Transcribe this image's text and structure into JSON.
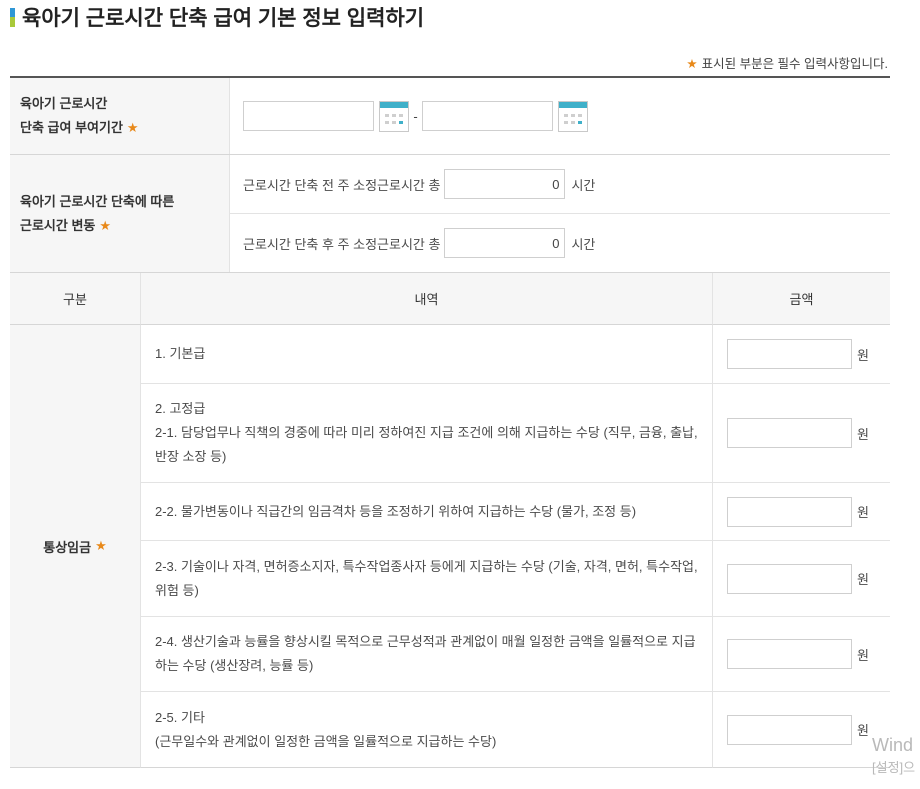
{
  "colors": {
    "required_mark": "#e8891a",
    "title_bar_top": "#2f97d6",
    "title_bar_bottom": "#a9c93a",
    "calendar_accent": "#3fb0c9"
  },
  "page": {
    "title": "육아기 근로시간 단축 급여 기본 정보 입력하기",
    "title_icon": "title-bullet-icon",
    "required_mark": "★",
    "required_note": "표시된 부분은 필수 입력사항입니다."
  },
  "period": {
    "label_lines": [
      "육아기 근로시간",
      "단축 급여 부여기간"
    ],
    "start_date": {
      "value": "",
      "icon": "calendar-icon"
    },
    "separator": "-",
    "end_date": {
      "value": "",
      "icon": "calendar-icon"
    }
  },
  "hours_change": {
    "label_lines": [
      "육아기 근로시간 단축에 따른",
      "근로시간 변동"
    ],
    "before": {
      "label": "근로시간 단축 전 주 소정근로시간 총",
      "value": "0",
      "unit": "시간"
    },
    "after": {
      "label": "근로시간 단축 후 주 소정근로시간 총",
      "value": "0",
      "unit": "시간"
    }
  },
  "wage_table": {
    "headers": [
      "구분",
      "내역",
      "금액"
    ],
    "category": "통상임금",
    "currency_unit": "원",
    "rows": [
      {
        "lines": [
          "1. 기본급"
        ],
        "amount": ""
      },
      {
        "lines": [
          "2. 고정급",
          "2-1. 담당업무나 직책의 경중에 따라 미리 정하여진 지급 조건에 의해 지급하는 수당 (직무, 금융, 출납, 반장 소장 등)"
        ],
        "amount": ""
      },
      {
        "lines": [
          "2-2. 물가변동이나 직급간의 임금격차 등을 조정하기 위하여 지급하는 수당 (물가, 조정 등)"
        ],
        "amount": ""
      },
      {
        "lines": [
          "2-3. 기술이나 자격, 면허증소지자, 특수작업종사자 등에게 지급하는 수당 (기술, 자격, 면허, 특수작업, 위험 등)"
        ],
        "amount": ""
      },
      {
        "lines": [
          "2-4. 생산기술과 능률을 향상시킬 목적으로 근무성적과 관계없이 매월 일정한 금액을 일률적으로 지급하는 수당 (생산장려, 능률 등)"
        ],
        "amount": ""
      },
      {
        "lines": [
          "2-5. 기타",
          "(근무일수와 관계없이 일정한 금액을 일률적으로 지급하는 수당)"
        ],
        "amount": ""
      }
    ]
  },
  "watermark": {
    "line1": "Wind",
    "line2": "[설정]으"
  }
}
